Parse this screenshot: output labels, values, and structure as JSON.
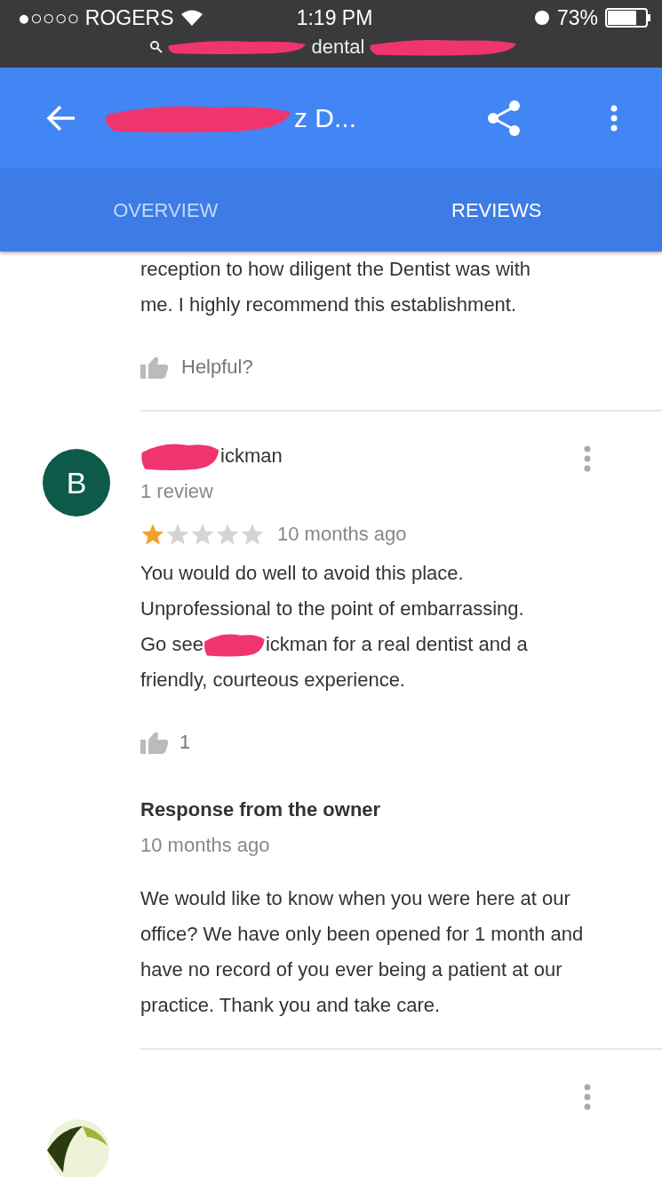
{
  "status_bar": {
    "carrier": "●○○○○ ROGERS",
    "time": "1:19 PM",
    "battery": "73%",
    "url": "dental"
  },
  "app_bar": {
    "title": "z D..."
  },
  "tabs": [
    {
      "label": "OVERVIEW",
      "selected": false
    },
    {
      "label": "REVIEWS",
      "selected": true
    }
  ],
  "previous_review": {
    "text_lines": [
      "reception to how diligent the Dentist was with",
      "me. I highly recommend this establishment."
    ],
    "helpful": "Helpful?"
  },
  "review": {
    "avatar": "B",
    "author": "ickman",
    "count": "1 review",
    "stars": 1,
    "time": "10 months ago",
    "text_lines": [
      "You would do well to avoid this place.",
      "Unprofessional to the point of embarrassing."
    ],
    "go_see": "Go see",
    "text_after": "ickman for a real dentist and a",
    "last_line": "friendly, courteous experience.",
    "likes": "1",
    "response": {
      "title": "Response from the owner",
      "time": "10 months ago",
      "text": "We would like to know when you were here at our office? We have only been opened for 1 month and have no record of you ever being a patient at our practice. Thank you and take care."
    }
  }
}
